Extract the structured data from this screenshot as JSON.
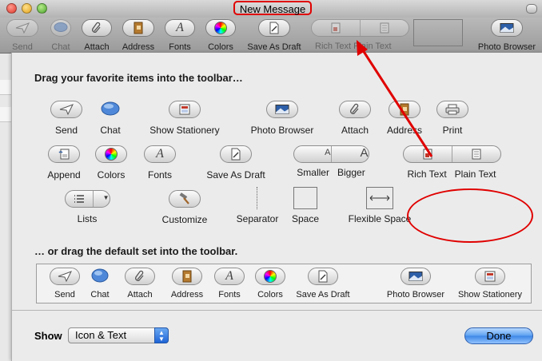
{
  "window": {
    "title": "New Message"
  },
  "toolbar": {
    "items": [
      {
        "label": "Send",
        "icon": "paper-plane-icon"
      },
      {
        "label": "Chat",
        "icon": "chat-bubble-icon"
      },
      {
        "label": "Attach",
        "icon": "paperclip-icon"
      },
      {
        "label": "Address",
        "icon": "address-book-icon"
      },
      {
        "label": "Fonts",
        "icon": "font-a-icon"
      },
      {
        "label": "Colors",
        "icon": "color-wheel-icon"
      },
      {
        "label": "Save As Draft",
        "icon": "draft-page-icon"
      },
      {
        "label": "Rich Text",
        "icon": "rich-text-icon"
      },
      {
        "label": "Plain Text",
        "icon": "plain-text-icon"
      },
      {
        "label": "Photo Browser",
        "icon": "photo-icon"
      }
    ]
  },
  "customize": {
    "heading": "Drag your favorite items into the toolbar…",
    "palette": [
      {
        "label": "Send",
        "icon": "paper-plane-icon"
      },
      {
        "label": "Chat",
        "icon": "chat-bubble-icon"
      },
      {
        "label": "Show Stationery",
        "icon": "stationery-icon"
      },
      {
        "label": "Photo Browser",
        "icon": "photo-icon"
      },
      {
        "label": "Attach",
        "icon": "paperclip-icon"
      },
      {
        "label": "Address",
        "icon": "address-book-icon"
      },
      {
        "label": "Print",
        "icon": "printer-icon"
      },
      {
        "label": "Append",
        "icon": "append-icon"
      },
      {
        "label": "Colors",
        "icon": "color-wheel-icon"
      },
      {
        "label": "Fonts",
        "icon": "font-a-icon"
      },
      {
        "label": "Save As Draft",
        "icon": "draft-page-icon"
      },
      {
        "label": "Smaller",
        "icon": "font-smaller-icon"
      },
      {
        "label": "Bigger",
        "icon": "font-bigger-icon"
      },
      {
        "label": "Rich Text",
        "icon": "rich-text-icon"
      },
      {
        "label": "Plain Text",
        "icon": "plain-text-icon"
      },
      {
        "label": "Lists",
        "icon": "list-icon"
      },
      {
        "label": "Customize",
        "icon": "hammer-icon"
      },
      {
        "label": "Separator",
        "icon": "separator-icon"
      },
      {
        "label": "Space",
        "icon": "space-icon"
      },
      {
        "label": "Flexible Space",
        "icon": "flexible-space-icon"
      }
    ],
    "default_heading": "… or drag the default set into the toolbar.",
    "default_set": [
      {
        "label": "Send"
      },
      {
        "label": "Chat"
      },
      {
        "label": "Attach"
      },
      {
        "label": "Address"
      },
      {
        "label": "Fonts"
      },
      {
        "label": "Colors"
      },
      {
        "label": "Save As Draft"
      },
      {
        "label": "Photo Browser"
      },
      {
        "label": "Show Stationery"
      }
    ],
    "show_label": "Show",
    "show_value": "Icon & Text",
    "done_label": "Done"
  },
  "annotation_color": "#e00000",
  "accent_color": "#3d86e6"
}
